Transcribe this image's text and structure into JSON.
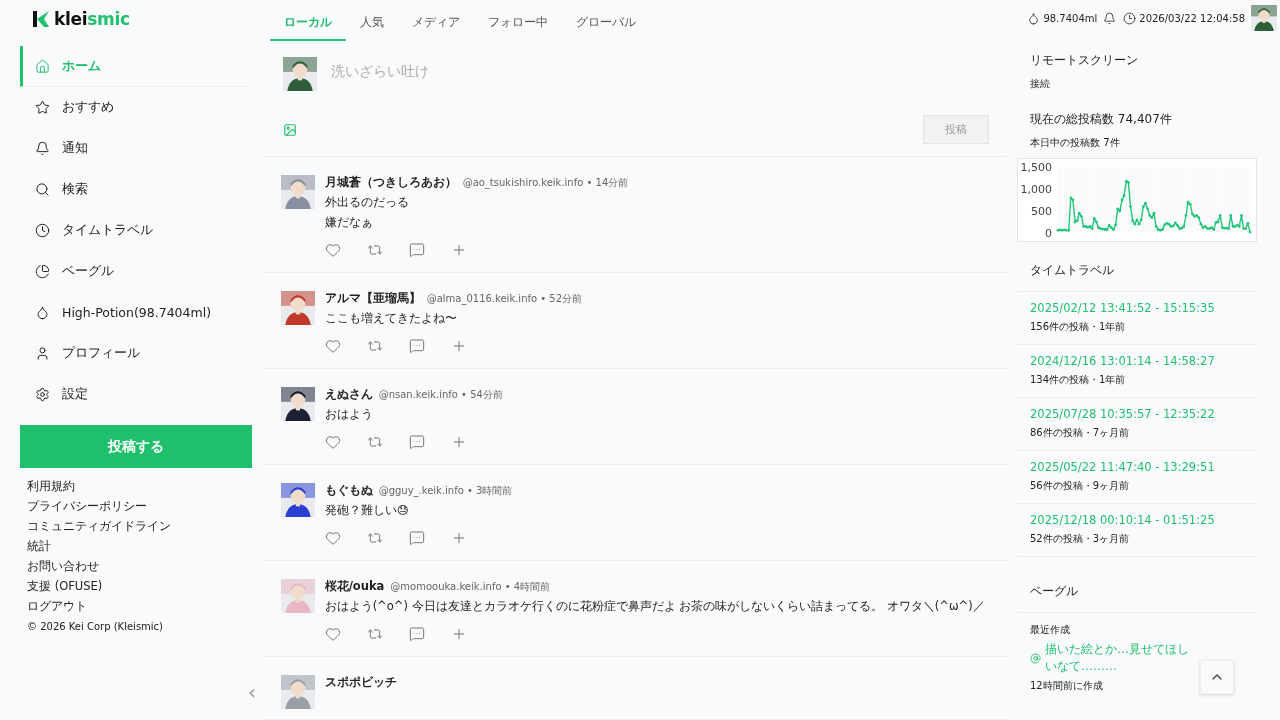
{
  "logo": {
    "text_a": "klei",
    "text_b": "smic"
  },
  "nav": [
    {
      "label": "ホーム",
      "selected": true
    },
    {
      "label": "おすすめ",
      "selected": false
    },
    {
      "label": "通知",
      "selected": false
    },
    {
      "label": "検索",
      "selected": false
    },
    {
      "label": "タイムトラベル",
      "selected": false
    },
    {
      "label": "ベーグル",
      "selected": false
    },
    {
      "label": "High-Potion(98.7404ml)",
      "selected": false
    },
    {
      "label": "プロフィール",
      "selected": false
    },
    {
      "label": "設定",
      "selected": false
    }
  ],
  "post_button": "投稿する",
  "footer_links": [
    "利用規約",
    "プライバシーポリシー",
    "コミュニティガイドライン",
    "統計",
    "お問い合わせ",
    "支援 (OFUSE)",
    "ログアウト"
  ],
  "copyright": "© 2026 Kei Corp (Kleismic)",
  "collapse": "‹",
  "tabs": [
    {
      "label": "ローカル",
      "selected": true
    },
    {
      "label": "人気",
      "selected": false
    },
    {
      "label": "メディア",
      "selected": false
    },
    {
      "label": "フォロー中",
      "selected": false
    },
    {
      "label": "グローバル",
      "selected": false
    }
  ],
  "composer": {
    "placeholder": "洗いざらい吐け",
    "submit": "投稿",
    "disabled": true
  },
  "posts": [
    {
      "name": "月城蒼（つきしろあお）",
      "meta": "@ao_tsukishiro.keik.info • 14分前",
      "lines": [
        "外出るのだっる",
        "嫌だなぁ"
      ]
    },
    {
      "name": "アルマ【亜瑠馬】",
      "meta": "@alma_0116.keik.info • 52分前",
      "lines": [
        "ここも増えてきたよね〜"
      ]
    },
    {
      "name": "えぬさん",
      "meta": "@nsan.keik.info • 54分前",
      "lines": [
        "おはよう"
      ]
    },
    {
      "name": "もぐもぬ",
      "meta": "@gguy_.keik.info • 3時間前",
      "lines": [
        "発砲？難しい😓"
      ]
    },
    {
      "name": "桜花/ouka",
      "meta": "@momoouka.keik.info • 4時間前",
      "lines": [
        "おはよう(^o^) 今日は友達とカラオケ行くのに花粉症で鼻声だよ お茶の味がしないくらい詰まってる。 オワタ＼(^ω^)／"
      ]
    },
    {
      "name": "スポポビッチ"
    }
  ],
  "header": {
    "potion": "98.7404ml",
    "datetime": "2026/03/22 12:04:58"
  },
  "remote": {
    "title": "リモートスクリーン",
    "status": "接続"
  },
  "stats": {
    "title": "現在の総投稿数 74,407件",
    "today": "本日中の投稿数 7件",
    "chart_data": {
      "type": "line",
      "ylim": [
        0,
        1500
      ],
      "yticks": [
        {
          "value": 0,
          "label": "0"
        },
        {
          "value": 500,
          "label": "500"
        },
        {
          "value": 1000,
          "label": "1,000"
        },
        {
          "value": 1500,
          "label": "1,500"
        }
      ],
      "series": [
        {
          "color": "#22c57a",
          "values": [
            60,
            70,
            60,
            70,
            60,
            60,
            800,
            750,
            250,
            280,
            450,
            380,
            150,
            150,
            130,
            150,
            100,
            330,
            250,
            120,
            100,
            90,
            80,
            80,
            170,
            120,
            80,
            180,
            550,
            500,
            750,
            850,
            1180,
            1150,
            600,
            280,
            200,
            300,
            200,
            300,
            600,
            680,
            550,
            400,
            350,
            450,
            150,
            80,
            60,
            80,
            190,
            220,
            200,
            150,
            160,
            230,
            170,
            100,
            110,
            150,
            400,
            700,
            650,
            430,
            380,
            400,
            350,
            200,
            120,
            150,
            100,
            100,
            120,
            80,
            240,
            250,
            400,
            120,
            110,
            110,
            100,
            400,
            150,
            150,
            180,
            150,
            400,
            100,
            100,
            220,
            20
          ]
        }
      ]
    }
  },
  "timetravel": {
    "title": "タイムトラベル",
    "items": [
      {
        "range": "2025/02/12 13:41:52 - 15:15:35",
        "meta": "156件の投稿・1年前"
      },
      {
        "range": "2024/12/16 13:01:14 - 14:58:27",
        "meta": "134件の投稿・1年前"
      },
      {
        "range": "2025/07/28 10:35:57 - 12:35:22",
        "meta": "86件の投稿・7ヶ月前"
      },
      {
        "range": "2025/05/22 11:47:40 - 13:29:51",
        "meta": "56件の投稿・9ヶ月前"
      },
      {
        "range": "2025/12/18 00:10:14 - 01:51:25",
        "meta": "52件の投稿・3ヶ月前"
      }
    ]
  },
  "bagel": {
    "title": "ベーグル",
    "label": "最近作成",
    "item": "描いた絵とか…見せてほしいなて………",
    "created": "12時間前に作成"
  }
}
